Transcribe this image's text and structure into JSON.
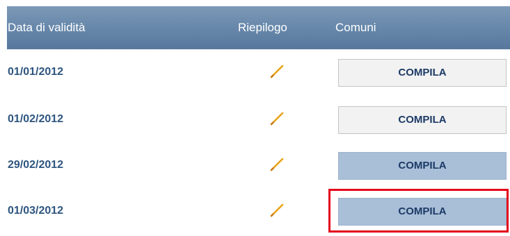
{
  "header": {
    "date_label": "Data di validità",
    "riepilogo_label": "Riepilogo",
    "comuni_label": "Comuni"
  },
  "rows": [
    {
      "date": "01/01/2012",
      "button": "COMPILA",
      "state": "normal"
    },
    {
      "date": "01/02/2012",
      "button": "COMPILA",
      "state": "normal"
    },
    {
      "date": "29/02/2012",
      "button": "COMPILA",
      "state": "active"
    },
    {
      "date": "01/03/2012",
      "button": "COMPILA",
      "state": "active"
    }
  ],
  "icons": {
    "riepilogo": "pencil-icon"
  },
  "colors": {
    "header_bg": "#6788ab",
    "date_text": "#2e557f",
    "button_active_bg": "#a9bfd8",
    "button_normal_bg": "#f2f2f2",
    "highlight_border": "#e3001b"
  }
}
